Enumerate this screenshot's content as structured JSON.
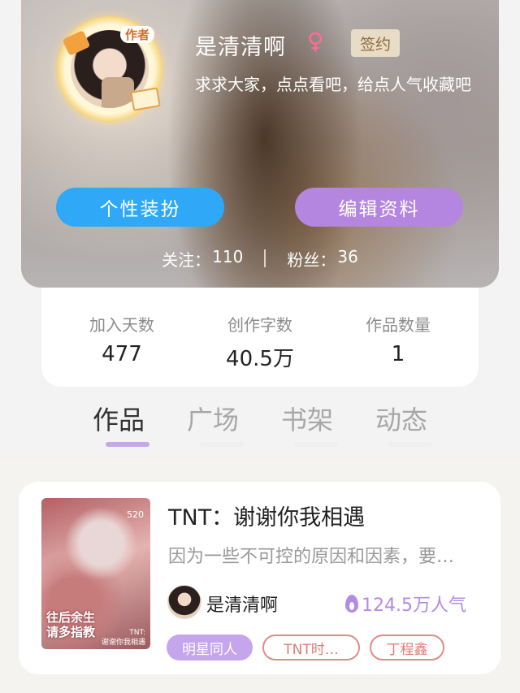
{
  "profile": {
    "author_badge": "作者",
    "username": "是清清啊",
    "gender_symbol": "♀",
    "signed_badge": "签约",
    "bio": "求求大家，点点看吧，给点人气收藏吧",
    "dress_button": "个性装扮",
    "edit_button": "编辑资料",
    "follow_label": "关注：",
    "follow_count": "110",
    "fans_label": "粉丝：",
    "fans_count": "36"
  },
  "stats": [
    {
      "label": "加入天数",
      "value": "477"
    },
    {
      "label": "创作字数",
      "value": "40.5万"
    },
    {
      "label": "作品数量",
      "value": "1"
    }
  ],
  "tabs": [
    {
      "label": "作品",
      "active": true
    },
    {
      "label": "广场",
      "active": false
    },
    {
      "label": "书架",
      "active": false
    },
    {
      "label": "动态",
      "active": false
    }
  ],
  "work": {
    "cover_number": "520",
    "cover_title_line1": "往后余生",
    "cover_title_line2": "请多指教",
    "cover_sub_line1": "TNT:",
    "cover_sub_line2": "谢谢你我相遇",
    "title": "TNT：谢谢你我相遇",
    "description": "因为一些不可控的原因和因素，要…",
    "author": "是清清啊",
    "popularity": "124.5万人气",
    "tags": [
      "明星同人",
      "TNT时…",
      "丁程鑫"
    ]
  },
  "colors": {
    "dress_button": "#2ea8f7",
    "edit_button": "#b486e0",
    "accent_purple": "#b28be3",
    "tag_outline": "#e08b85"
  }
}
